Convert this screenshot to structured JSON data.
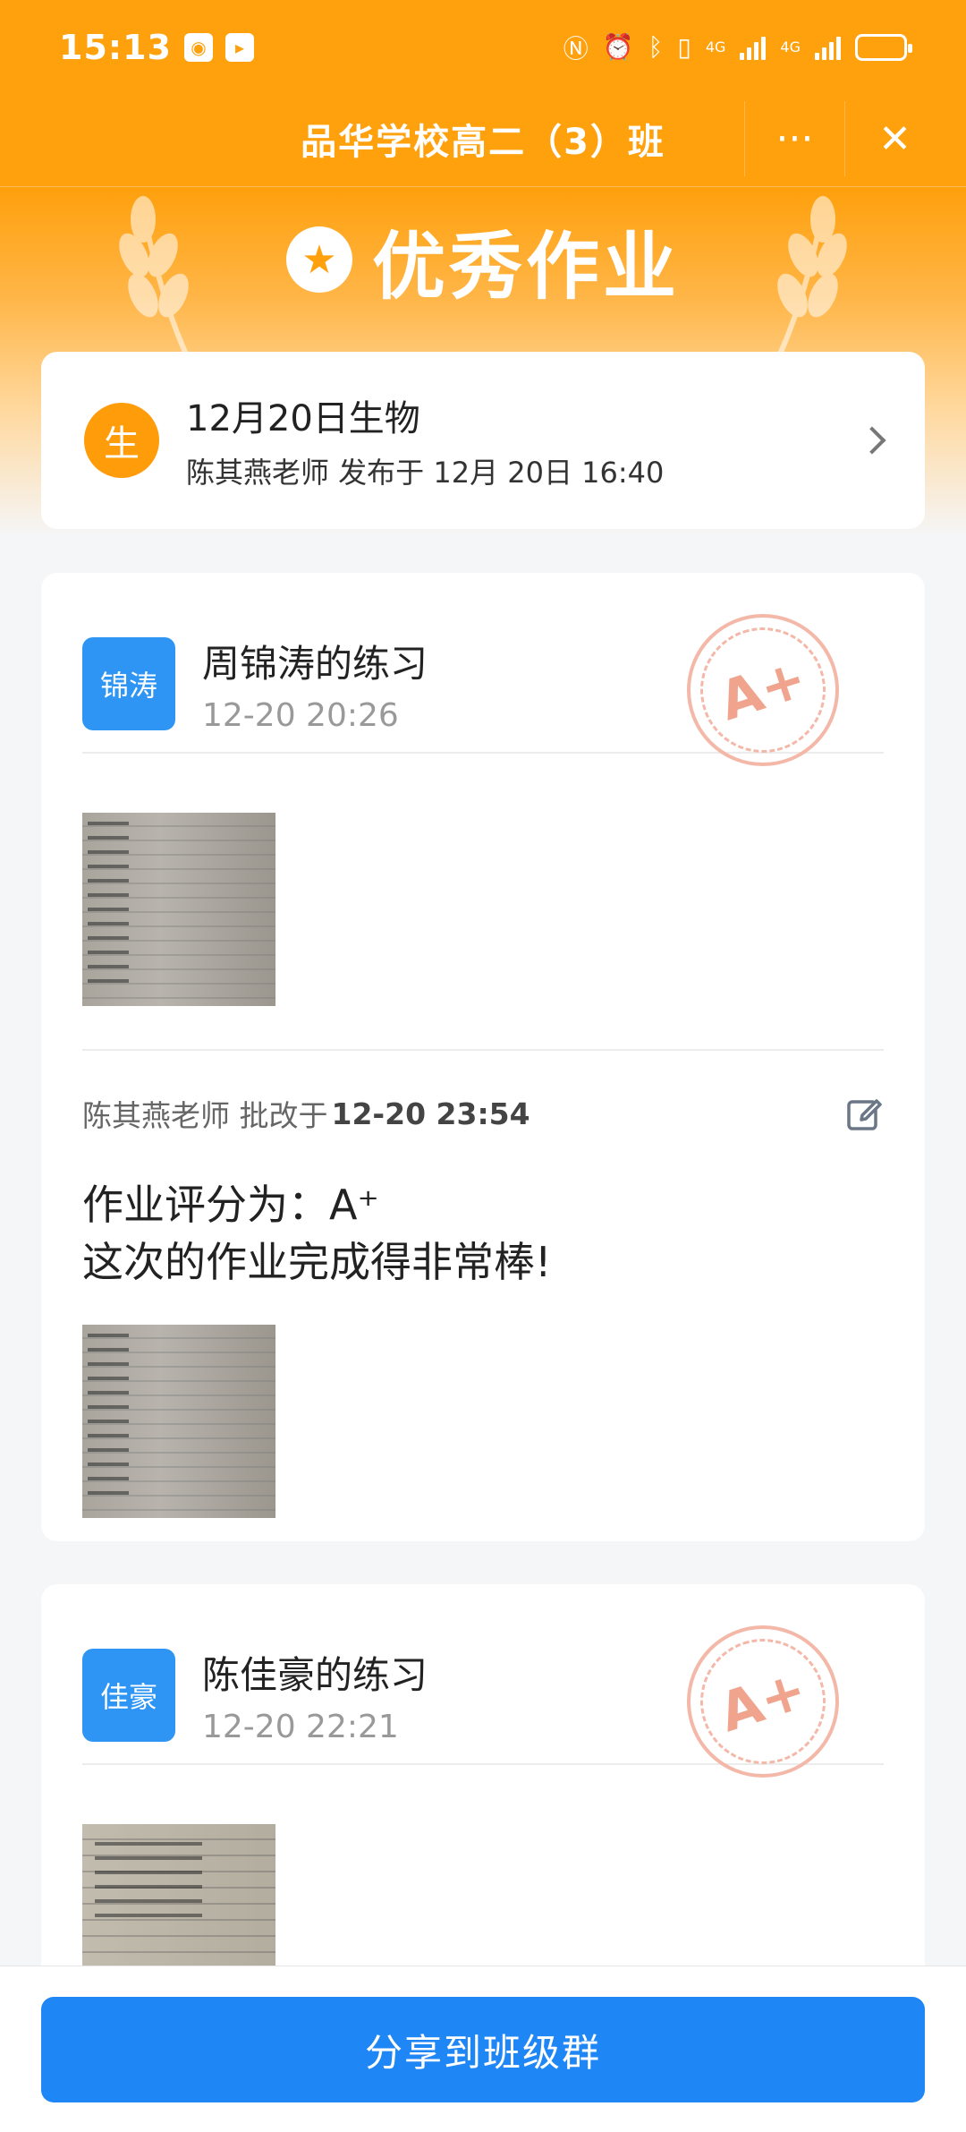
{
  "status_bar": {
    "time": "15:13",
    "network_1": "4G",
    "network_2": "4G"
  },
  "nav": {
    "title": "品华学校高二（3）班",
    "more_label": "···",
    "close_label": "✕"
  },
  "banner": {
    "title": "优秀作业"
  },
  "assignment": {
    "avatar_text": "生",
    "title": "12月20日生物",
    "subtitle": "陈其燕老师 发布于 12月 20日 16:40"
  },
  "submissions": [
    {
      "avatar_text": "锦涛",
      "name": "周锦涛的练习",
      "time": "12-20 20:26",
      "grade_stamp": "A+",
      "review": {
        "teacher_prefix": "陈其燕老师 批改于",
        "time": "12-20 23:54",
        "line1": "作业评分为：A⁺",
        "line2": "这次的作业完成得非常棒!"
      }
    },
    {
      "avatar_text": "佳豪",
      "name": "陈佳豪的练习",
      "time": "12-20 22:21",
      "grade_stamp": "A+"
    }
  ],
  "footer": {
    "share_label": "分享到班级群"
  },
  "colors": {
    "header_orange": "#ffa00d",
    "primary_blue": "#1f86f5",
    "student_avatar_blue": "#2e95f4",
    "stamp_red": "#f0a48e"
  }
}
